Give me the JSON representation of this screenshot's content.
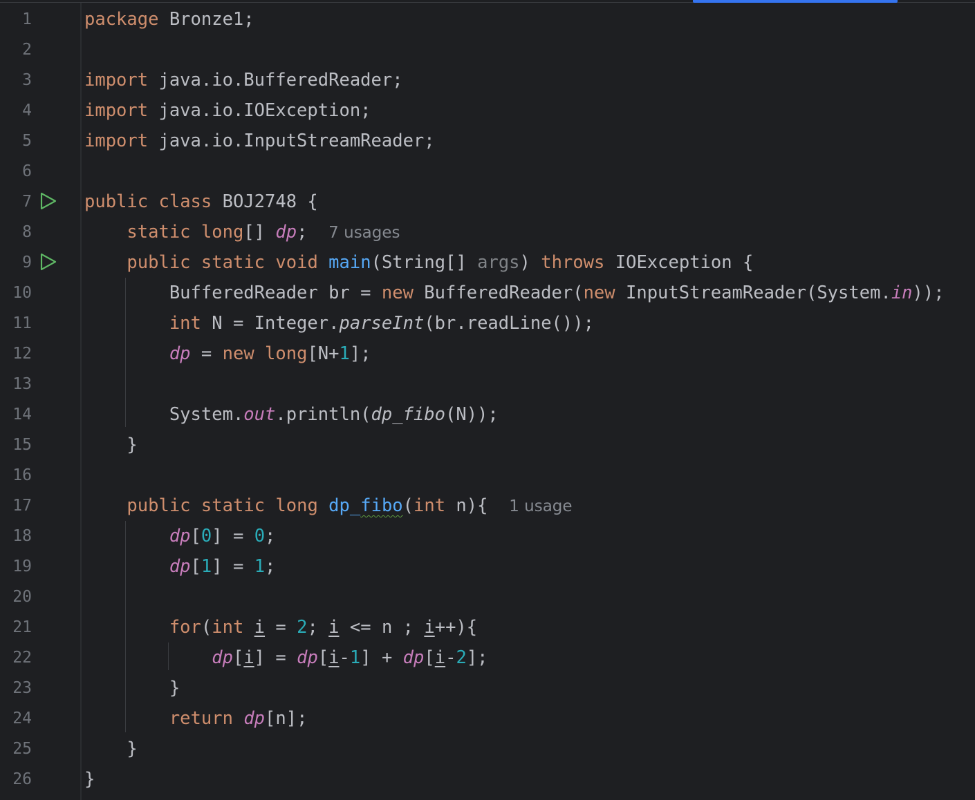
{
  "editor": {
    "language": "java",
    "accent_color": "#3574f0",
    "background": "#1e1f22",
    "line_numbers": [
      "1",
      "2",
      "3",
      "4",
      "5",
      "6",
      "7",
      "8",
      "9",
      "10",
      "11",
      "12",
      "13",
      "14",
      "15",
      "16",
      "17",
      "18",
      "19",
      "20",
      "21",
      "22",
      "23",
      "24",
      "25",
      "26"
    ],
    "run_gutter_icons": [
      {
        "line": 7,
        "icon": "run-triangle-icon"
      },
      {
        "line": 9,
        "icon": "run-triangle-icon"
      }
    ],
    "tokens": {
      "l1_kw": "package",
      "l1_rest": " Bronze1;",
      "l3_kw": "import",
      "l3_rest": " java.io.BufferedReader;",
      "l4_kw": "import",
      "l4_rest": " java.io.IOException;",
      "l5_kw": "import",
      "l5_rest": " java.io.InputStreamReader;",
      "l7_kw1": "public",
      "l7_kw2": "class",
      "l7_rest": " BOJ2748 {",
      "l8_indent": "    ",
      "l8_kw1": "static",
      "l8_kw2": "long",
      "l8_rest1": "[] ",
      "l8_field": "dp",
      "l8_rest2": ";  ",
      "l8_hint": "7 usages",
      "l9_indent": "    ",
      "l9_kw1": "public",
      "l9_kw2": "static",
      "l9_kw3": "void",
      "l9_fn": "main",
      "l9_rest1": "(String[] ",
      "l9_param": "args",
      "l9_rest2": ") ",
      "l9_kw4": "throws",
      "l9_rest3": " IOException {",
      "l10_indent": "        ",
      "l10_a": "BufferedReader br = ",
      "l10_kw1": "new",
      "l10_b": " BufferedReader(",
      "l10_kw2": "new",
      "l10_c": " InputStreamReader(System.",
      "l10_field": "in",
      "l10_d": "));",
      "l11_indent": "        ",
      "l11_kw": "int",
      "l11_a": " N = Integer.",
      "l11_static": "parseInt",
      "l11_b": "(br.readLine());",
      "l12_indent": "        ",
      "l12_field": "dp",
      "l12_a": " = ",
      "l12_kw1": "new",
      "l12_kw2": "long",
      "l12_b": "[N+",
      "l12_num": "1",
      "l12_c": "];",
      "l14_indent": "        ",
      "l14_a": "System.",
      "l14_field": "out",
      "l14_b": ".println(",
      "l14_static": "dp_fibo",
      "l14_c": "(N));",
      "l15_text": "    }",
      "l17_indent": "    ",
      "l17_kw1": "public",
      "l17_kw2": "static",
      "l17_kw3": "long",
      "l17_fn1": "dp_",
      "l17_fn2": "fibo",
      "l17_a": "(",
      "l17_kw4": "int",
      "l17_b": " n){  ",
      "l17_hint": "1 usage",
      "l18_indent": "        ",
      "l18_field": "dp",
      "l18_a": "[",
      "l18_num1": "0",
      "l18_b": "] = ",
      "l18_num2": "0",
      "l18_c": ";",
      "l19_indent": "        ",
      "l19_field": "dp",
      "l19_a": "[",
      "l19_num1": "1",
      "l19_b": "] = ",
      "l19_num2": "1",
      "l19_c": ";",
      "l21_indent": "        ",
      "l21_kw1": "for",
      "l21_a": "(",
      "l21_kw2": "int",
      "l21_b": " ",
      "l21_v1": "i",
      "l21_c": " = ",
      "l21_num": "2",
      "l21_d": "; ",
      "l21_v2": "i",
      "l21_e": " <= n ; ",
      "l21_v3": "i",
      "l21_f": "++){",
      "l22_indent": "            ",
      "l22_f1": "dp",
      "l22_a": "[",
      "l22_v1": "i",
      "l22_b": "] = ",
      "l22_f2": "dp",
      "l22_c": "[",
      "l22_v2": "i",
      "l22_d": "-",
      "l22_n1": "1",
      "l22_e": "] + ",
      "l22_f3": "dp",
      "l22_g": "[",
      "l22_v3": "i",
      "l22_h": "-",
      "l22_n2": "2",
      "l22_i": "];",
      "l23_text": "        }",
      "l24_indent": "        ",
      "l24_kw": "return",
      "l24_a": " ",
      "l24_field": "dp",
      "l24_b": "[n];",
      "l25_text": "    }",
      "l26_text": "}"
    }
  }
}
